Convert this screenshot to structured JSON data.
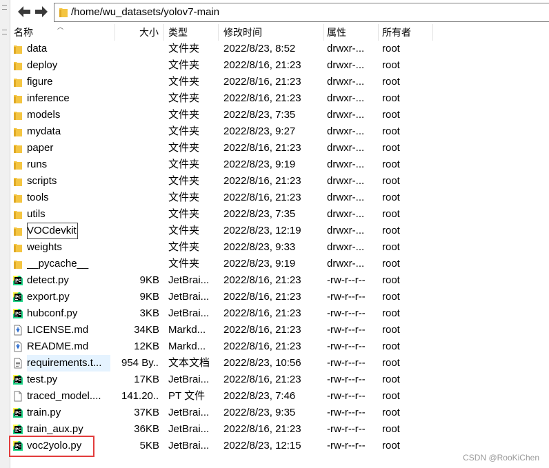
{
  "address": {
    "path": "/home/wu_datasets/yolov7-main"
  },
  "columns": [
    "名称",
    "大小",
    "类型",
    "修改时间",
    "属性",
    "所有者"
  ],
  "files": [
    {
      "name": "data",
      "size": "",
      "type": "文件夹",
      "modified": "2022/8/23, 8:52",
      "perm": "drwxr-...",
      "owner": "root",
      "icon": "folder-icon"
    },
    {
      "name": "deploy",
      "size": "",
      "type": "文件夹",
      "modified": "2022/8/16, 21:23",
      "perm": "drwxr-...",
      "owner": "root",
      "icon": "folder-icon"
    },
    {
      "name": "figure",
      "size": "",
      "type": "文件夹",
      "modified": "2022/8/16, 21:23",
      "perm": "drwxr-...",
      "owner": "root",
      "icon": "folder-icon"
    },
    {
      "name": "inference",
      "size": "",
      "type": "文件夹",
      "modified": "2022/8/16, 21:23",
      "perm": "drwxr-...",
      "owner": "root",
      "icon": "folder-icon"
    },
    {
      "name": "models",
      "size": "",
      "type": "文件夹",
      "modified": "2022/8/23, 7:35",
      "perm": "drwxr-...",
      "owner": "root",
      "icon": "folder-icon"
    },
    {
      "name": "mydata",
      "size": "",
      "type": "文件夹",
      "modified": "2022/8/23, 9:27",
      "perm": "drwxr-...",
      "owner": "root",
      "icon": "folder-icon"
    },
    {
      "name": "paper",
      "size": "",
      "type": "文件夹",
      "modified": "2022/8/16, 21:23",
      "perm": "drwxr-...",
      "owner": "root",
      "icon": "folder-icon"
    },
    {
      "name": "runs",
      "size": "",
      "type": "文件夹",
      "modified": "2022/8/23, 9:19",
      "perm": "drwxr-...",
      "owner": "root",
      "icon": "folder-icon"
    },
    {
      "name": "scripts",
      "size": "",
      "type": "文件夹",
      "modified": "2022/8/16, 21:23",
      "perm": "drwxr-...",
      "owner": "root",
      "icon": "folder-icon"
    },
    {
      "name": "tools",
      "size": "",
      "type": "文件夹",
      "modified": "2022/8/16, 21:23",
      "perm": "drwxr-...",
      "owner": "root",
      "icon": "folder-icon"
    },
    {
      "name": "utils",
      "size": "",
      "type": "文件夹",
      "modified": "2022/8/23, 7:35",
      "perm": "drwxr-...",
      "owner": "root",
      "icon": "folder-icon"
    },
    {
      "name": "VOCdevkit",
      "size": "",
      "type": "文件夹",
      "modified": "2022/8/23, 12:19",
      "perm": "drwxr-...",
      "owner": "root",
      "icon": "folder-icon",
      "state": "focused"
    },
    {
      "name": "weights",
      "size": "",
      "type": "文件夹",
      "modified": "2022/8/23, 9:33",
      "perm": "drwxr-...",
      "owner": "root",
      "icon": "folder-icon"
    },
    {
      "name": "__pycache__",
      "size": "",
      "type": "文件夹",
      "modified": "2022/8/23, 9:19",
      "perm": "drwxr-...",
      "owner": "root",
      "icon": "folder-icon"
    },
    {
      "name": "detect.py",
      "size": "9KB",
      "type": "JetBrai...",
      "modified": "2022/8/16, 21:23",
      "perm": "-rw-r--r--",
      "owner": "root",
      "icon": "pycharm-file-icon"
    },
    {
      "name": "export.py",
      "size": "9KB",
      "type": "JetBrai...",
      "modified": "2022/8/16, 21:23",
      "perm": "-rw-r--r--",
      "owner": "root",
      "icon": "pycharm-file-icon"
    },
    {
      "name": "hubconf.py",
      "size": "3KB",
      "type": "JetBrai...",
      "modified": "2022/8/16, 21:23",
      "perm": "-rw-r--r--",
      "owner": "root",
      "icon": "pycharm-file-icon"
    },
    {
      "name": "LICENSE.md",
      "size": "34KB",
      "type": "Markd...",
      "modified": "2022/8/16, 21:23",
      "perm": "-rw-r--r--",
      "owner": "root",
      "icon": "markdown-file-icon"
    },
    {
      "name": "README.md",
      "size": "12KB",
      "type": "Markd...",
      "modified": "2022/8/16, 21:23",
      "perm": "-rw-r--r--",
      "owner": "root",
      "icon": "markdown-file-icon"
    },
    {
      "name": "requirements.t...",
      "size": "954 By...",
      "type": "文本文档",
      "modified": "2022/8/23, 10:56",
      "perm": "-rw-r--r--",
      "owner": "root",
      "icon": "text-file-icon",
      "state": "selected"
    },
    {
      "name": "test.py",
      "size": "17KB",
      "type": "JetBrai...",
      "modified": "2022/8/16, 21:23",
      "perm": "-rw-r--r--",
      "owner": "root",
      "icon": "pycharm-file-icon"
    },
    {
      "name": "traced_model....",
      "size": "141.20...",
      "type": "PT 文件",
      "modified": "2022/8/23, 7:46",
      "perm": "-rw-r--r--",
      "owner": "root",
      "icon": "blank-file-icon"
    },
    {
      "name": "train.py",
      "size": "37KB",
      "type": "JetBrai...",
      "modified": "2022/8/23, 9:35",
      "perm": "-rw-r--r--",
      "owner": "root",
      "icon": "pycharm-file-icon"
    },
    {
      "name": "train_aux.py",
      "size": "36KB",
      "type": "JetBrai...",
      "modified": "2022/8/16, 21:23",
      "perm": "-rw-r--r--",
      "owner": "root",
      "icon": "pycharm-file-icon"
    },
    {
      "name": "voc2yolo.py",
      "size": "5KB",
      "type": "JetBrai...",
      "modified": "2022/8/23, 12:15",
      "perm": "-rw-r--r--",
      "owner": "root",
      "icon": "pycharm-file-icon"
    }
  ],
  "watermark": "CSDN @RooKiChen",
  "colors": {
    "folder": "#f4c542",
    "highlight": "#e23b3b",
    "selection": "#e5f3ff",
    "pycharm_green": "#21d789"
  }
}
